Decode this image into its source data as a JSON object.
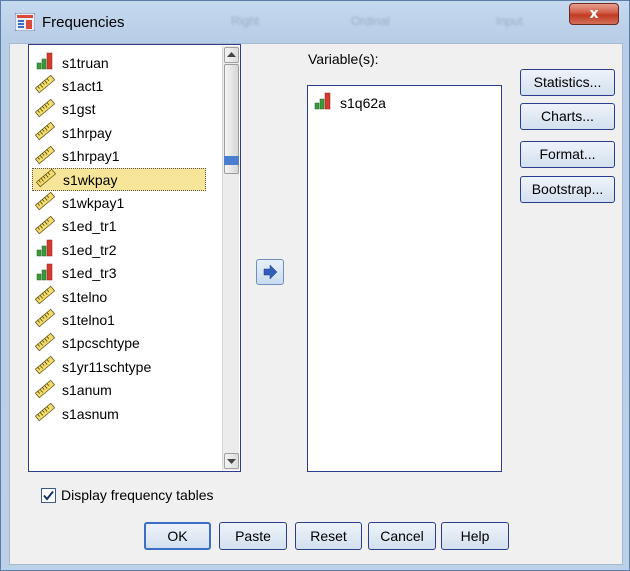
{
  "window": {
    "title": "Frequencies",
    "background_tabs": [
      "Right",
      "Ordinal",
      "Input"
    ],
    "close_label": "x"
  },
  "source_list": {
    "items": [
      {
        "label": "s1truan",
        "icon": "nominal-bar-icon"
      },
      {
        "label": "s1act1",
        "icon": "scale-ruler-icon"
      },
      {
        "label": "s1gst",
        "icon": "scale-ruler-icon"
      },
      {
        "label": "s1hrpay",
        "icon": "scale-ruler-icon"
      },
      {
        "label": "s1hrpay1",
        "icon": "scale-ruler-icon"
      },
      {
        "label": "s1wkpay",
        "icon": "scale-ruler-icon",
        "selected": true
      },
      {
        "label": "s1wkpay1",
        "icon": "scale-ruler-icon"
      },
      {
        "label": "s1ed_tr1",
        "icon": "scale-ruler-icon"
      },
      {
        "label": "s1ed_tr2",
        "icon": "nominal-bar-icon"
      },
      {
        "label": "s1ed_tr3",
        "icon": "nominal-bar-icon"
      },
      {
        "label": "s1telno",
        "icon": "scale-ruler-icon"
      },
      {
        "label": "s1telno1",
        "icon": "scale-ruler-icon"
      },
      {
        "label": "s1pcschtype",
        "icon": "scale-ruler-icon"
      },
      {
        "label": "s1yr11schtype",
        "icon": "scale-ruler-icon"
      },
      {
        "label": "s1anum",
        "icon": "scale-ruler-icon"
      },
      {
        "label": "s1asnum",
        "icon": "scale-ruler-icon"
      }
    ]
  },
  "target": {
    "label": "Variable(s):",
    "items": [
      {
        "label": "s1q62a",
        "icon": "nominal-bar-icon"
      }
    ]
  },
  "side_buttons": {
    "statistics": "Statistics...",
    "charts": "Charts...",
    "format": "Format...",
    "bootstrap": "Bootstrap..."
  },
  "checkbox": {
    "label": "Display frequency tables",
    "checked": true
  },
  "bottom_buttons": {
    "ok": "OK",
    "paste": "Paste",
    "reset": "Reset",
    "cancel": "Cancel",
    "help": "Help"
  },
  "colors": {
    "selection": "#f7e59a",
    "border_accent": "#2a3d8f",
    "close_red": "#c03a22"
  }
}
